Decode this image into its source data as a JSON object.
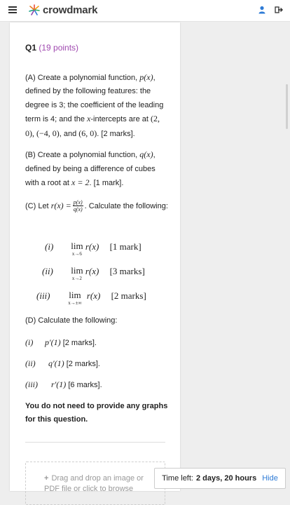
{
  "header": {
    "logo_text": "crowdmark",
    "menu_icon": "hamburger-icon",
    "user_icon": "user-icon",
    "logout_icon": "sign-out-icon",
    "accent": "#2e7bd6"
  },
  "question": {
    "label": "Q1",
    "points": "(19 points)",
    "a_pre": "(A) Create a polynomial function, ",
    "a_fn": "p(x)",
    "a_mid": ", defined by the following features: the degree is 3; the coefficient of the leading term is 4; and the ",
    "a_x": "x",
    "a_mid2": "-intercepts are at ",
    "a_pts": "(2, 0), (−4, 0)",
    "a_and": ", and ",
    "a_pt3": "(6, 0)",
    "a_marks": ". [2 marks].",
    "b_pre": "(B) Create a polynomial function, ",
    "b_fn": "q(x)",
    "b_mid": ", defined by being a difference of cubes with a root at ",
    "b_root": "x = 2",
    "b_marks": ". [1 mark].",
    "c_pre": "(C) Let ",
    "c_fn": "r(x) =",
    "c_num": "p(x)",
    "c_den": "q(x)",
    "c_post": ". Calculate the following:",
    "limits": [
      {
        "num": "(i)",
        "sub": "x→6",
        "expr": "r(x)",
        "marks": "[1 mark]"
      },
      {
        "num": "(ii)",
        "sub": "x→2",
        "expr": "r(x)",
        "marks": "[3 marks]"
      },
      {
        "num": "(iii)",
        "sub": "x→±∞",
        "expr": "r(x)",
        "marks": "[2 marks]"
      }
    ],
    "lim_word": "lim",
    "d_title": "(D) Calculate the following:",
    "derivs": [
      {
        "num": "(i)",
        "expr": "p′(1)",
        "marks": "[2 marks]."
      },
      {
        "num": "(ii)",
        "expr": "q′(1)",
        "marks": "[2 marks]."
      },
      {
        "num": "(iii)",
        "expr": "r′(1)",
        "marks": "[6 marks]."
      }
    ],
    "note": "You do not need to provide any graphs for this question."
  },
  "upload": {
    "text": "Drag and drop an image or PDF file or click to browse"
  },
  "timer": {
    "label": "Time left:",
    "value": "2 days, 20 hours",
    "hide": "Hide"
  }
}
